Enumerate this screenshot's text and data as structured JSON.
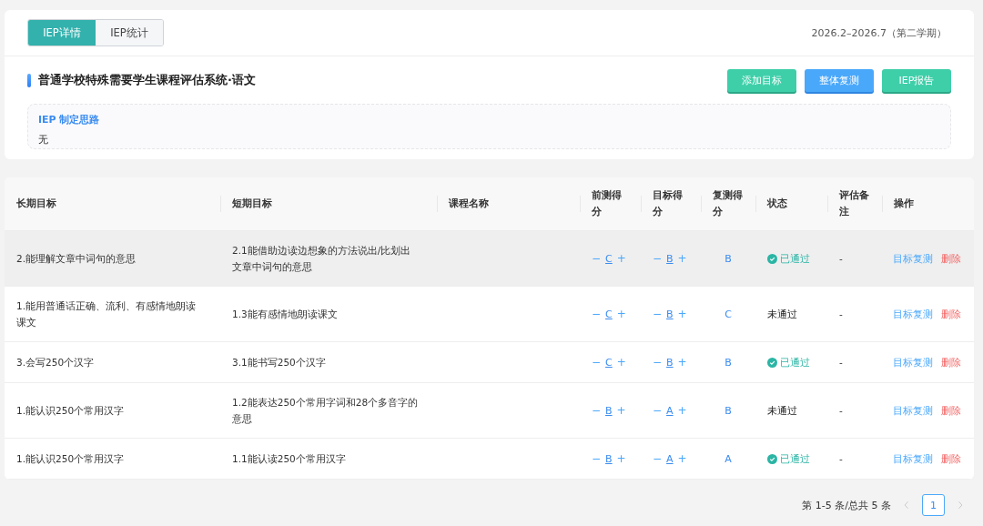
{
  "tabs": [
    {
      "label": "IEP详情",
      "selected": true
    },
    {
      "label": "IEP统计",
      "selected": false
    }
  ],
  "term": "2026.2–2026.7（第二学期）",
  "title": "普通学校特殊需要学生课程评估系统·语文",
  "actions": [
    {
      "label": "添加目标",
      "kind": "green"
    },
    {
      "label": "整体复测",
      "kind": "blue"
    },
    {
      "label": "IEP报告",
      "kind": "green"
    }
  ],
  "thinking": {
    "label": "IEP 制定思路",
    "text": "无"
  },
  "table": {
    "columns": [
      "长期目标",
      "短期目标",
      "课程名称",
      "前测得分",
      "目标得分",
      "复测得分",
      "状态",
      "评估备注",
      "操作"
    ],
    "rows": [
      {
        "highlighted": true,
        "long_goal": "2.能理解文章中词句的意思",
        "short_goal": "2.1能借助边读边想象的方法说出/比划出文章中词句的意思",
        "pre_score": {
          "minus": "−",
          "value": "C",
          "plus": "+"
        },
        "target_score": {
          "minus": "−",
          "value": "B",
          "plus": "+"
        },
        "retest_score": "B",
        "status": {
          "passed": true,
          "text": "已通过"
        },
        "note": "-",
        "ops": [
          "目标复测",
          "删除"
        ]
      },
      {
        "highlighted": false,
        "long_goal": "1.能用普通话正确、流利、有感情地朗读课文",
        "short_goal": "1.3能有感情地朗读课文",
        "pre_score": {
          "minus": "−",
          "value": "C",
          "plus": "+"
        },
        "target_score": {
          "minus": "−",
          "value": "B",
          "plus": "+"
        },
        "retest_score": "C",
        "status": {
          "passed": false,
          "text": "未通过"
        },
        "note": "-",
        "ops": [
          "目标复测",
          "删除"
        ]
      },
      {
        "highlighted": false,
        "long_goal": "3.会写250个汉字",
        "short_goal": "3.1能书写250个汉字",
        "pre_score": {
          "minus": "−",
          "value": "C",
          "plus": "+"
        },
        "target_score": {
          "minus": "−",
          "value": "B",
          "plus": "+"
        },
        "retest_score": "B",
        "status": {
          "passed": true,
          "text": "已通过"
        },
        "note": "-",
        "ops": [
          "目标复测",
          "删除"
        ]
      },
      {
        "highlighted": false,
        "long_goal": "1.能认识250个常用汉字",
        "short_goal": "1.2能表达250个常用字词和28个多音字的意思",
        "pre_score": {
          "minus": "−",
          "value": "B",
          "plus": "+"
        },
        "target_score": {
          "minus": "−",
          "value": "A",
          "plus": "+"
        },
        "retest_score": "B",
        "status": {
          "passed": false,
          "text": "未通过"
        },
        "note": "-",
        "ops": [
          "目标复测",
          "删除"
        ]
      },
      {
        "highlighted": false,
        "long_goal": "1.能认识250个常用汉字",
        "short_goal": "1.1能认读250个常用汉字",
        "pre_score": {
          "minus": "−",
          "value": "B",
          "plus": "+"
        },
        "target_score": {
          "minus": "−",
          "value": "A",
          "plus": "+"
        },
        "retest_score": "A",
        "status": {
          "passed": true,
          "text": "已通过"
        },
        "note": "-",
        "ops": [
          "目标复测",
          "删除"
        ]
      }
    ]
  },
  "pagination": {
    "summary": "第 1-5 条/总共 5 条",
    "pages": [
      {
        "label": "1",
        "selected": true
      }
    ]
  }
}
